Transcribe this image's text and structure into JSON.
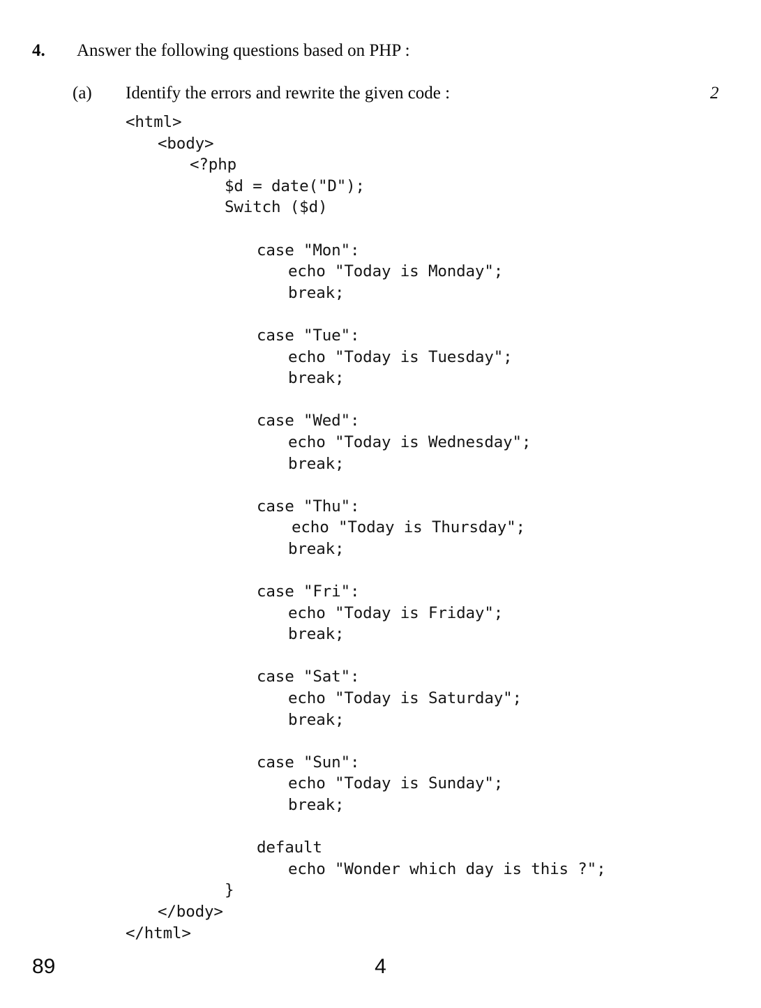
{
  "question": {
    "number": "4.",
    "text": "Answer the following questions based on PHP :",
    "sub_label": "(a)",
    "sub_text": "Identify the errors and rewrite the given code :",
    "marks": "2"
  },
  "code": {
    "lines": [
      {
        "indent": "i0",
        "text": "<html>"
      },
      {
        "indent": "i1",
        "text": "<body>"
      },
      {
        "indent": "i2",
        "text": "<?php"
      },
      {
        "indent": "i3",
        "text": "$d = date(\"D\");"
      },
      {
        "indent": "i3",
        "text": "Switch ($d)"
      },
      {
        "indent": "i0",
        "text": ""
      },
      {
        "indent": "i4",
        "text": "case \"Mon\":"
      },
      {
        "indent": "i5",
        "text": "echo \"Today is Monday\";"
      },
      {
        "indent": "i5",
        "text": "break;"
      },
      {
        "indent": "i0",
        "text": ""
      },
      {
        "indent": "i4",
        "text": "case \"Tue\":"
      },
      {
        "indent": "i5",
        "text": "echo \"Today is Tuesday\";"
      },
      {
        "indent": "i5",
        "text": "break;"
      },
      {
        "indent": "i0",
        "text": ""
      },
      {
        "indent": "i4",
        "text": "case \"Wed\":"
      },
      {
        "indent": "i5",
        "text": "echo \"Today is Wednesday\";"
      },
      {
        "indent": "i5",
        "text": "break;"
      },
      {
        "indent": "i0",
        "text": ""
      },
      {
        "indent": "i4",
        "text": "case \"Thu\":"
      },
      {
        "indent": "i5b",
        "text": "echo \"Today is Thursday\";"
      },
      {
        "indent": "i5",
        "text": "break;"
      },
      {
        "indent": "i0",
        "text": ""
      },
      {
        "indent": "i4",
        "text": "case \"Fri\":"
      },
      {
        "indent": "i5",
        "text": "echo \"Today is Friday\";"
      },
      {
        "indent": "i5",
        "text": "break;"
      },
      {
        "indent": "i0",
        "text": ""
      },
      {
        "indent": "i4",
        "text": "case \"Sat\":"
      },
      {
        "indent": "i5",
        "text": "echo \"Today is Saturday\";"
      },
      {
        "indent": "i5",
        "text": "break;"
      },
      {
        "indent": "i0",
        "text": ""
      },
      {
        "indent": "i4",
        "text": "case \"Sun\":"
      },
      {
        "indent": "i5",
        "text": "echo \"Today is Sunday\";"
      },
      {
        "indent": "i5",
        "text": "break;"
      },
      {
        "indent": "i0",
        "text": ""
      },
      {
        "indent": "i4",
        "text": "default"
      },
      {
        "indent": "i5",
        "text": "echo \"Wonder which day is this ?\";"
      },
      {
        "indent": "i3",
        "text": "}"
      },
      {
        "indent": "i1",
        "text": "</body>"
      },
      {
        "indent": "i0",
        "text": "</html>"
      }
    ]
  },
  "footer": {
    "left": "89",
    "center": "4"
  }
}
